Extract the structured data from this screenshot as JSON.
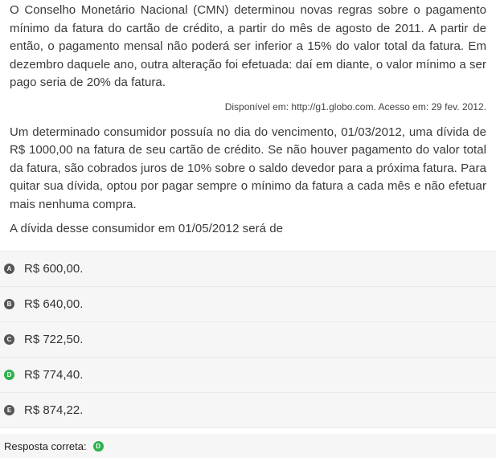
{
  "statement": {
    "paragraph1": "O Conselho Monetário Nacional (CMN) determinou novas regras sobre o pagamento mínimo da fatura do cartão de crédito, a partir do mês de agosto de 2011. A partir de então, o pagamento mensal não poderá ser inferior a 15% do valor total da fatura. Em dezembro daquele ano, outra alteração foi efetuada: daí em diante, o valor mínimo a ser pago seria de 20% da fatura.",
    "source": "Disponível em: http://g1.globo.com. Acesso em: 29 fev. 2012.",
    "paragraph2": "Um determinado consumidor possuía no dia do vencimento, 01/03/2012, uma dívida de R$ 1000,00 na fatura de seu cartão de crédito. Se não houver pagamento do valor total da fatura, são cobrados juros de 10% sobre o saldo devedor para a próxima fatura. Para quitar sua dívida, optou por pagar sempre o mínimo da fatura a cada mês e não efetuar mais nenhuma compra.",
    "question": "A dívida desse consumidor em 01/05/2012 será de"
  },
  "alternatives": [
    {
      "letter": "A",
      "text": "R$ 600,00."
    },
    {
      "letter": "B",
      "text": "R$ 640,00."
    },
    {
      "letter": "C",
      "text": "R$ 722,50."
    },
    {
      "letter": "D",
      "text": "R$ 774,40."
    },
    {
      "letter": "E",
      "text": "R$ 874,22."
    }
  ],
  "answer": {
    "label": "Resposta correta:",
    "letter": "D"
  },
  "colors": {
    "badge_default": "#555555",
    "badge_correct": "#2bb24c",
    "row_background": "#f6f6f6"
  }
}
